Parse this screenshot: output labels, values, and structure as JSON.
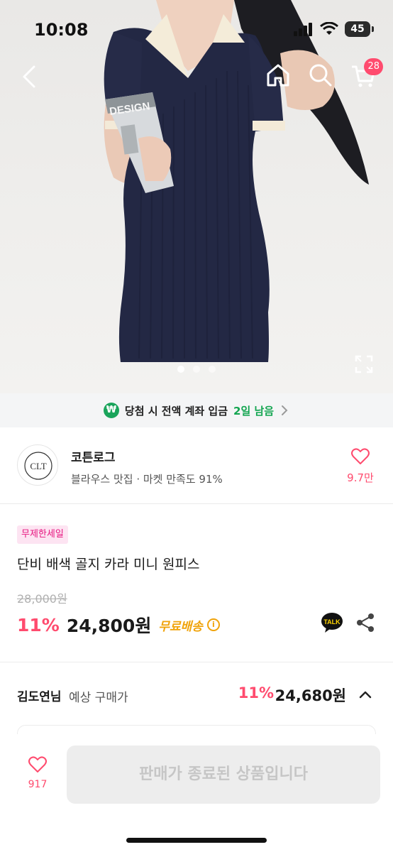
{
  "status_bar": {
    "time": "10:08",
    "battery": "45"
  },
  "header": {
    "cart_count": "28"
  },
  "gallery": {
    "total_images": 3,
    "active_index": 0
  },
  "event_banner": {
    "icon": "₩",
    "text": "당첨 시 전액 계좌 입금",
    "days_left": "2일 남음"
  },
  "store": {
    "logo_text": "CLT",
    "name": "코튼로그",
    "subtitle": "블라우스 맛집 · 마켓 만족도 91%",
    "like_count": "9.7만"
  },
  "product": {
    "badge": "무제한세일",
    "title": "단비 배색 골지 카라 미니 원피스",
    "original_price": "28,000원",
    "discount_rate": "11%",
    "price": "24,800원",
    "shipping": "무료배송",
    "info_icon": "i",
    "talk_label": "TALK"
  },
  "expected_purchase": {
    "user_name": "김도연님",
    "label": "예상 구매가",
    "discount_rate": "11%",
    "price": "24,680원"
  },
  "bottom_bar": {
    "like_count": "917",
    "buy_button_label": "판매가 종료된 상품입니다"
  },
  "colors": {
    "accent_pink": "#ff4b6e",
    "free_ship": "#f0a30a",
    "event_green": "#13a550",
    "badge_pink": "#e6157f"
  },
  "icons": [
    "back-icon",
    "home-icon",
    "search-icon",
    "cart-icon",
    "expand-icon",
    "heart-icon",
    "talk-icon",
    "share-icon",
    "chevron-up-icon",
    "chevron-right-icon",
    "info-icon"
  ]
}
